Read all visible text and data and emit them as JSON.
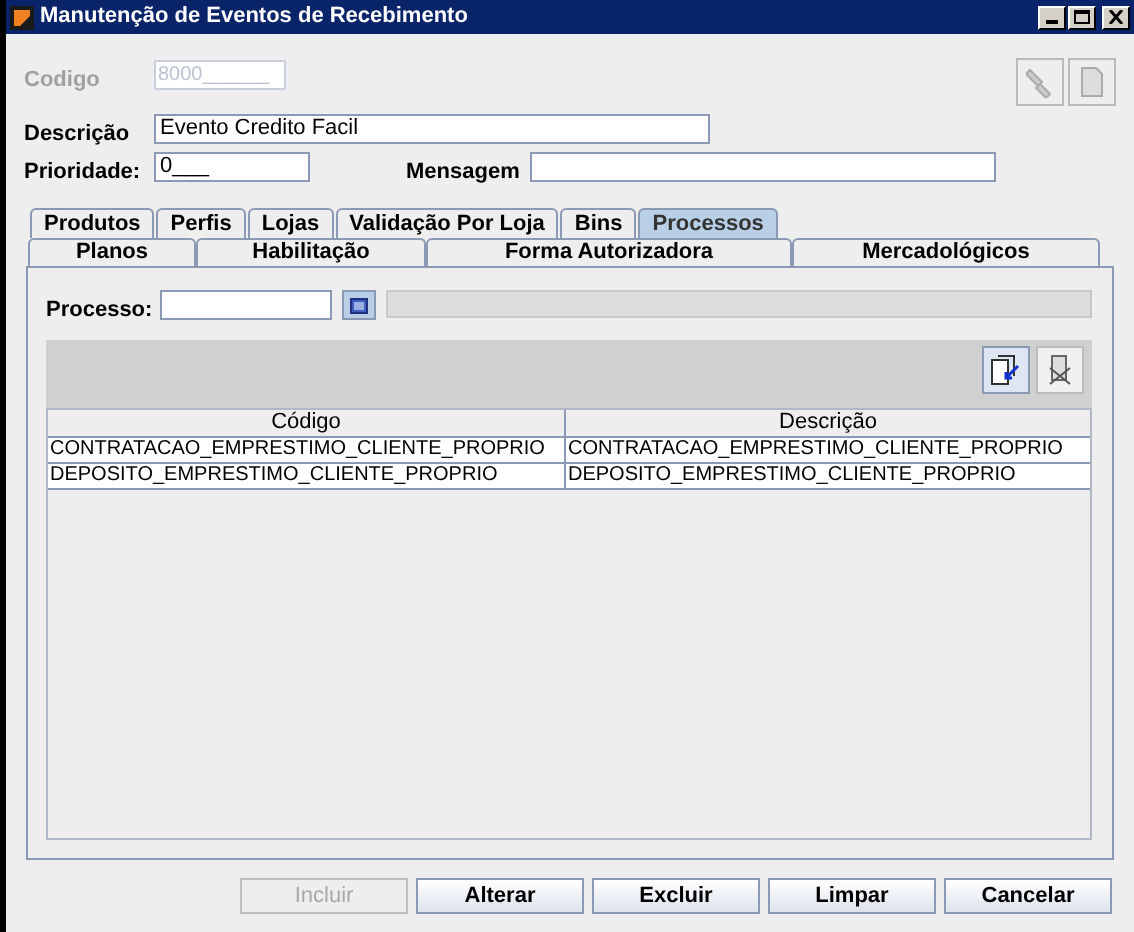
{
  "window": {
    "title": "Manutenção de Eventos de Recebimento"
  },
  "form": {
    "codigo": {
      "label": "Codigo",
      "value": "8000______",
      "disabled": true
    },
    "descricao": {
      "label": "Descrição",
      "value": "Evento Credito Facil"
    },
    "prioridade": {
      "label": "Prioridade:",
      "value": "0___"
    },
    "mensagem": {
      "label": "Mensagem"
    }
  },
  "tabs_row_1": [
    {
      "label": "Produtos",
      "selected": false
    },
    {
      "label": "Perfis",
      "selected": false
    },
    {
      "label": "Lojas",
      "selected": false
    },
    {
      "label": "Validação Por Loja",
      "selected": false
    },
    {
      "label": "Bins",
      "selected": false
    },
    {
      "label": "Processos",
      "selected": true
    }
  ],
  "tabs_row_2": [
    {
      "label": "Planos",
      "selected": false
    },
    {
      "label": "Habilitação",
      "selected": false
    },
    {
      "label": "Forma Autorizadora",
      "selected": false
    },
    {
      "label": "Mercadológicos",
      "selected": false
    }
  ],
  "processo": {
    "label": "Processo:"
  },
  "table": {
    "columns": [
      "Código",
      "Descrição"
    ],
    "rows": [
      [
        "CONTRATACAO_EMPRESTIMO_CLIENTE_PROPRIO",
        "CONTRATACAO_EMPRESTIMO_CLIENTE_PROPRIO"
      ],
      [
        "DEPOSITO_EMPRESTIMO_CLIENTE_PROPRIO",
        "DEPOSITO_EMPRESTIMO_CLIENTE_PROPRIO"
      ]
    ]
  },
  "buttons": [
    {
      "label": "Incluir",
      "disabled": true
    },
    {
      "label": "Alterar",
      "disabled": false
    },
    {
      "label": "Excluir",
      "disabled": false
    },
    {
      "label": "Limpar",
      "disabled": false
    },
    {
      "label": "Cancelar",
      "disabled": false
    }
  ]
}
